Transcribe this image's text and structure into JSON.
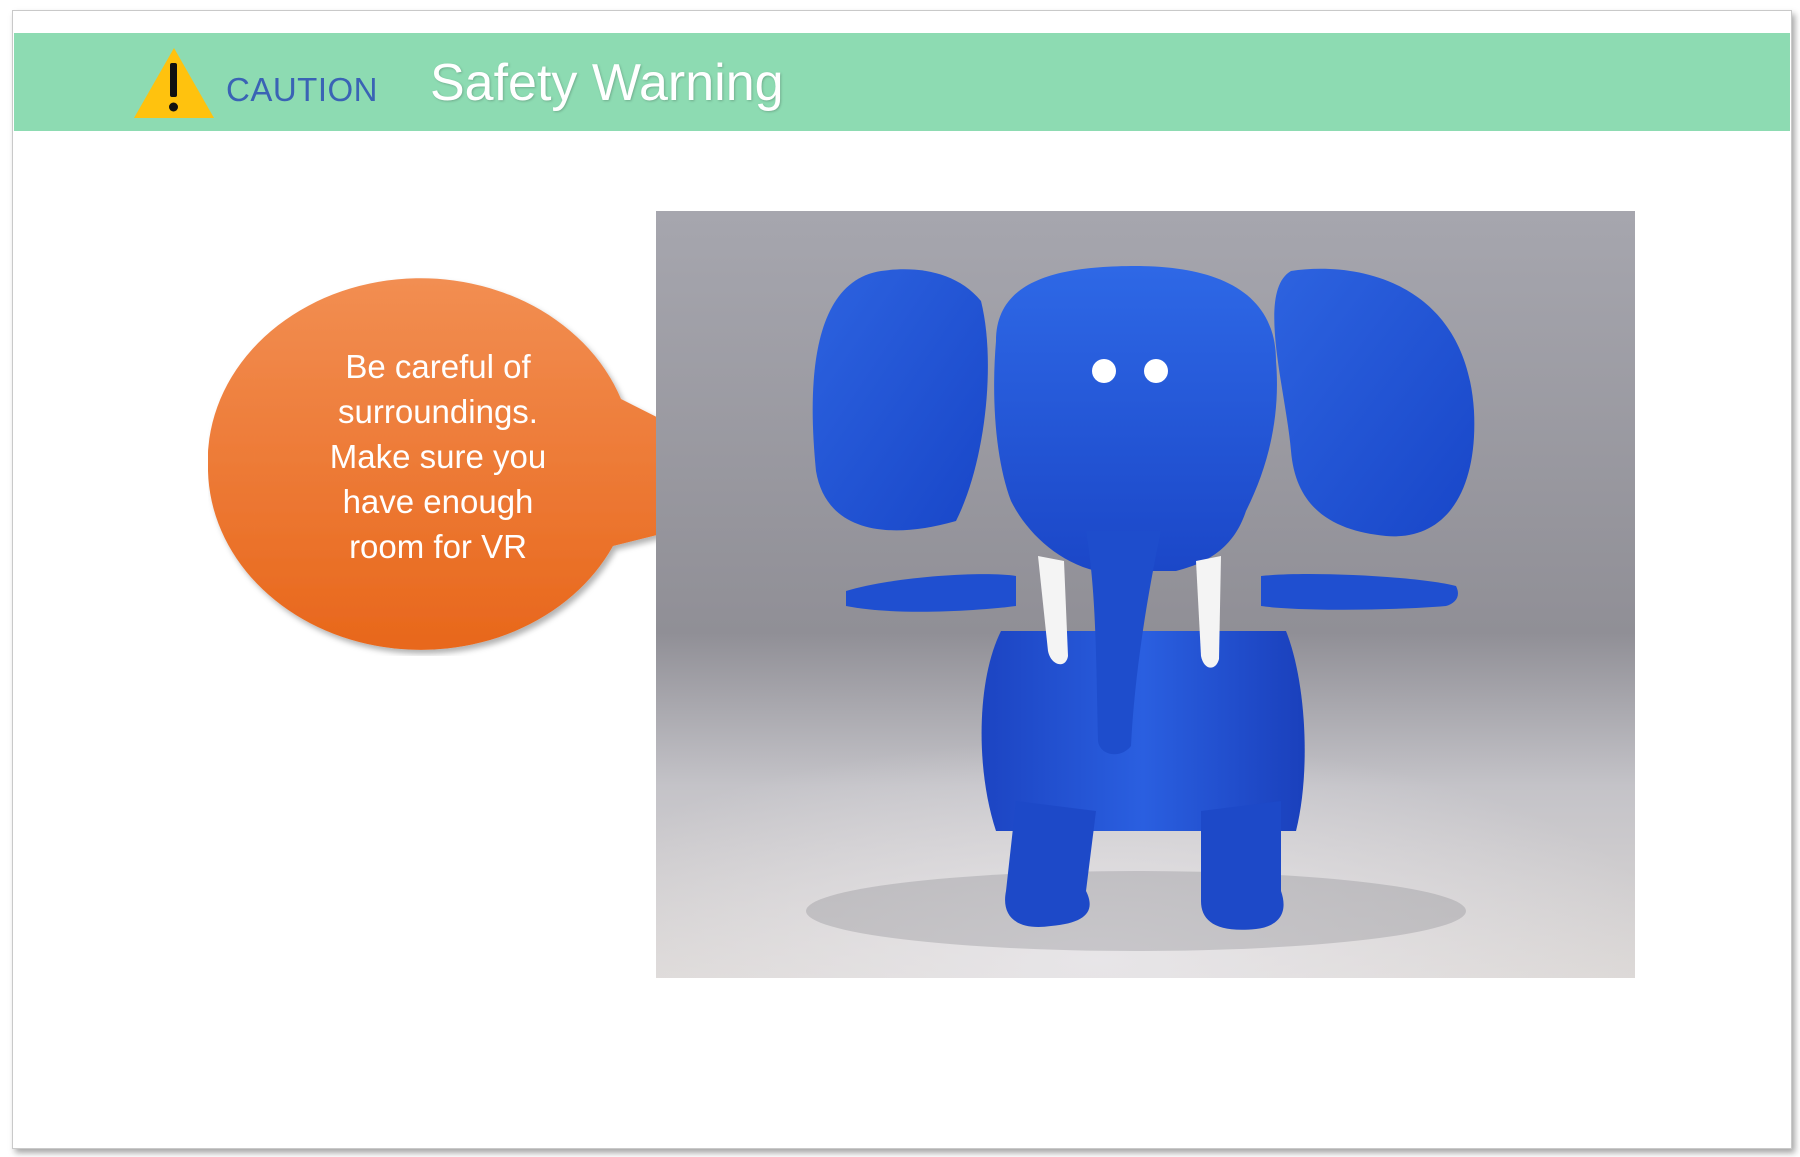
{
  "header": {
    "caution_label": "CAUTION",
    "title": "Safety Warning",
    "icon": "warning-triangle-icon"
  },
  "callout": {
    "lines": [
      "Be careful of",
      "surroundings.",
      "Make sure you",
      "have enough",
      "room for VR"
    ]
  },
  "image": {
    "subject": "blue-elephant-3d-model"
  },
  "colors": {
    "header_bar": "#8ddbb2",
    "caution_text": "#3a63b5",
    "callout_fill_top": "#f28e52",
    "callout_fill_bottom": "#e8671b",
    "elephant_blue": "#1f4fd0",
    "warning_yellow": "#ffc20e"
  }
}
